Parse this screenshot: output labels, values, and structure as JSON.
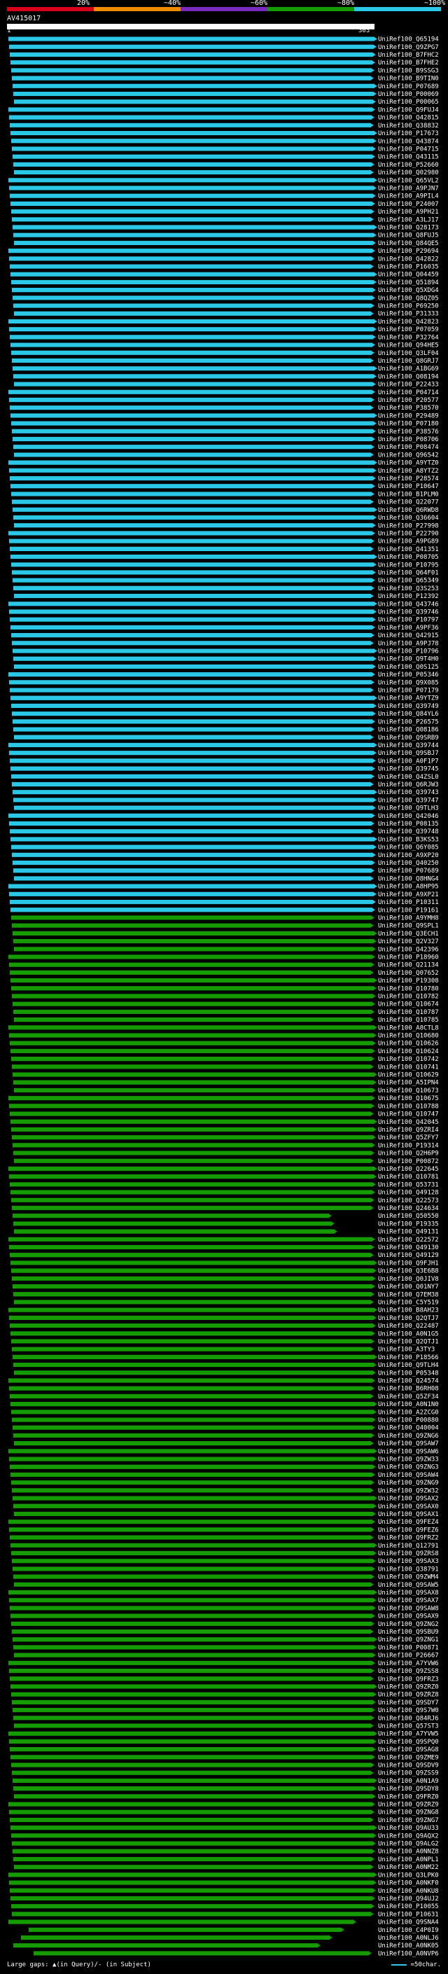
{
  "query": {
    "name": "AV415017",
    "start_label": "1",
    "end_label": "303"
  },
  "identity_scale": {
    "labels": [
      "20%",
      "~40%",
      "~60%",
      "~80%",
      "~100%"
    ],
    "colors": [
      "#d9001b",
      "#f08c00",
      "#7b2cbf",
      "#159b00",
      "#2ac7e6"
    ]
  },
  "footer": {
    "large_gaps": "Large gaps: ▲(in Query)/- (in Subject)",
    "scale": "=50char."
  },
  "chart_data": {
    "type": "alignment-overview",
    "query_length": 303,
    "series": [
      {
        "name": "~100%",
        "color": "#2ac7e6"
      },
      {
        "name": "~80%",
        "color": "#159b00"
      }
    ],
    "hits": [
      "UniRef100_Q65194",
      "UniRef100_Q9ZPG7",
      "UniRef100_B7FHC2",
      "UniRef100_B7FHE2",
      "UniRef100_B9SSG3",
      "UniRef100_B9TIN0",
      "UniRef100_P07689",
      "UniRef100_P00069",
      "UniRef100_P00065",
      "UniRef100_Q9FUJ4",
      "UniRef100_Q42815",
      "UniRef100_Q38832",
      "UniRef100_P17673",
      "UniRef100_Q43874",
      "UniRef100_P04715",
      "UniRef100_Q43115",
      "UniRef100_P52660",
      "UniRef100_Q02980",
      "UniRef100_Q65VL2",
      "UniRef100_A9PJN7",
      "UniRef100_A9PIL4",
      "UniRef100_P24007",
      "UniRef100_A9PH21",
      "UniRef100_A3LJ17",
      "UniRef100_Q28173",
      "UniRef100_Q8FUJ5",
      "UniRef100_Q84QE5",
      "UniRef100_P29694",
      "UniRef100_Q42822",
      "UniRef100_P16035",
      "UniRef100_Q04459",
      "UniRef100_Q51894",
      "UniRef100_Q5XDG4",
      "UniRef100_Q8QZ05",
      "UniRef100_P69250",
      "UniRef100_P31333",
      "UniRef100_Q42823",
      "UniRef100_P07059",
      "UniRef100_P32764",
      "UniRef100_Q94HE5",
      "UniRef100_Q3LF04",
      "UniRef100_Q8GRJ7",
      "UniRef100_A1BG69",
      "UniRef100_Q08194",
      "UniRef100_P22433",
      "UniRef100_P04714",
      "UniRef100_P20577",
      "UniRef100_P38570",
      "UniRef100_P29489",
      "UniRef100_P07180",
      "UniRef100_P38576",
      "UniRef100_P08706",
      "UniRef100_P08474",
      "UniRef100_Q96542",
      "UniRef100_A9YTZ0",
      "UniRef100_A8YTZ2",
      "UniRef100_P28574",
      "UniRef100_P10647",
      "UniRef100_B1PLM0",
      "UniRef100_Q22077",
      "UniRef100_Q6RWD8",
      "UniRef100_Q36604",
      "UniRef100_P27998",
      "UniRef100_P22790",
      "UniRef100_A9PG89",
      "UniRef100_Q41351",
      "UniRef100_P08705",
      "UniRef100_P10795",
      "UniRef100_Q64F01",
      "UniRef100_Q65349",
      "UniRef100_Q3S253",
      "UniRef100_P12392",
      "UniRef100_Q43746",
      "UniRef100_Q39746",
      "UniRef100_P10797",
      "UniRef100_A9PF36",
      "UniRef100_Q42915",
      "UniRef100_A9PJ78",
      "UniRef100_P10796",
      "UniRef100_Q9T4H0",
      "UniRef100_Q0S125",
      "UniRef100_P05346",
      "UniRef100_Q9X085",
      "UniRef100_P07179",
      "UniRef100_A9YTZ9",
      "UniRef100_Q39749",
      "UniRef100_Q84YL6",
      "UniRef100_P26575",
      "UniRef100_Q08186",
      "UniRef100_Q9SRB9",
      "UniRef100_Q39744",
      "UniRef100_Q9SBJ7",
      "UniRef100_A0F1P7",
      "UniRef100_Q39745",
      "UniRef100_Q4ZSL0",
      "UniRef100_Q6RJW3",
      "UniRef100_Q39743",
      "UniRef100_Q39747",
      "UniRef100_Q9TLH3",
      "UniRef100_Q42046",
      "UniRef100_P08135",
      "UniRef100_Q39748",
      "UniRef100_B3KS53",
      "UniRef100_Q6Y085",
      "UniRef100_A9XP20",
      "UniRef100_Q40250",
      "UniRef100_P07689",
      "UniRef100_Q8HNG4",
      "UniRef100_A8HP95",
      "UniRef100_A9XP21",
      "UniRef100_P10311",
      "UniRef100_P19161",
      "UniRef100_A9YMH8",
      "UniRef100_Q9SPL1",
      "UniRef100_Q3ECH1",
      "UniRef100_Q2V327",
      "UniRef100_Q42396",
      "UniRef100_P18960",
      "UniRef100_Q21134",
      "UniRef100_Q07652",
      "UniRef100_P19308",
      "UniRef100_Q10780",
      "UniRef100_Q10782",
      "UniRef100_Q10674",
      "UniRef100_Q10787",
      "UniRef100_Q10785",
      "UniRef100_A8CTL8",
      "UniRef100_Q10680",
      "UniRef100_Q10626",
      "UniRef100_Q10624",
      "UniRef100_Q10742",
      "UniRef100_Q10741",
      "UniRef100_Q10629",
      "UniRef100_A5IPN4",
      "UniRef100_Q10673",
      "UniRef100_Q10675",
      "UniRef100_Q10788",
      "UniRef100_Q10747",
      "UniRef100_Q42045",
      "UniRef100_Q9ZRI4",
      "UniRef100_Q5ZFY7",
      "UniRef100_P19314",
      "UniRef100_Q2H6P9",
      "UniRef100_P00872",
      "UniRef100_Q22645",
      "UniRef100_Q10781",
      "UniRef100_Q53731",
      "UniRef100_Q49128",
      "UniRef100_Q22573",
      "UniRef100_Q24634",
      "UniRef100_Q50550",
      "UniRef100_P19335",
      "UniRef100_Q49131",
      "UniRef100_Q22572",
      "UniRef100_Q49130",
      "UniRef100_Q49129",
      "UniRef100_Q9FJH1",
      "UniRef100_Q3E6B8",
      "UniRef100_Q0JIV8",
      "UniRef100_Q01NY7",
      "UniRef100_Q7EM38",
      "UniRef100_C5Y519",
      "UniRef100_B8AH23",
      "UniRef100_Q2QTJ7",
      "UniRef100_Q22487",
      "UniRef100_A0N1G5",
      "UniRef100_Q2QTJ1",
      "UniRef100_A3TY3",
      "UniRef100_P18566",
      "UniRef100_Q9TLH4",
      "UniRef100_P05348",
      "UniRef100_Q24574",
      "UniRef100_B6RH08",
      "UniRef100_Q5ZF34",
      "UniRef100_A0N1N0",
      "UniRef100_A2ZCG0",
      "UniRef100_P00880",
      "UniRef100_Q40004",
      "UniRef100_Q9ZNG6",
      "UniRef100_Q9SAW7",
      "UniRef100_Q9SAW6",
      "UniRef100_Q9ZW33",
      "UniRef100_Q9ZNG3",
      "UniRef100_Q9SAW4",
      "UniRef100_Q9ZNG9",
      "UniRef100_Q9ZW32",
      "UniRef100_Q9SAX2",
      "UniRef100_Q9SAX0",
      "UniRef100_Q9SAX1",
      "UniRef100_Q9FEZ4",
      "UniRef100_Q9FEZ6",
      "UniRef100_Q9FRZ2",
      "UniRef100_Q12791",
      "UniRef100_Q9ZRS8",
      "UniRef100_Q9SAX3",
      "UniRef100_Q38791",
      "UniRef100_Q9ZWM4",
      "UniRef100_Q9SAW5",
      "UniRef100_Q9SAX8",
      "UniRef100_Q9SAX7",
      "UniRef100_Q9SAW8",
      "UniRef100_Q9SAX9",
      "UniRef100_Q9ZNG2",
      "UniRef100_Q9SBU9",
      "UniRef100_Q9ZNG1",
      "UniRef100_P00871",
      "UniRef100_P26667",
      "UniRef100_A7YVW6",
      "UniRef100_Q9ZSS8",
      "UniRef100_Q9FRZ3",
      "UniRef100_Q9ZRZ0",
      "UniRef100_Q9ZRZ8",
      "UniRef100_Q9SDY7",
      "UniRef100_Q9S7W0",
      "UniRef100_Q84RJ6",
      "UniRef100_Q57ST3",
      "UniRef100_A7YVW5",
      "UniRef100_Q9SPQ0",
      "UniRef100_Q9SAG8",
      "UniRef100_Q9ZME9",
      "UniRef100_Q9SDV9",
      "UniRef100_Q9ZSS9",
      "UniRef100_A0N1A9",
      "UniRef100_Q9SDY8",
      "UniRef100_Q9FRZ0",
      "UniRef100_Q9ZRZ9",
      "UniRef100_Q9ZNG8",
      "UniRef100_Q9ZNG7",
      "UniRef100_Q9AU33",
      "UniRef100_Q9AQX2",
      "UniRef100_Q9ALG2",
      "UniRef100_A0NNZ8",
      "UniRef100_A0NPL1",
      "UniRef100_A0NM22",
      "UniRef100_Q3LPK0",
      "UniRef100_A0NKF0",
      "UniRef100_A0NKU8",
      "UniRef100_Q94UJ2",
      "UniRef100_P10055",
      "UniRef100_P10631",
      "UniRef100_Q9SNA4",
      "UniRef100_C4P0I9",
      "UniRef100_A0NLJ6",
      "UniRef100_A0NK05",
      "UniRef100_A0NVP6"
    ]
  }
}
